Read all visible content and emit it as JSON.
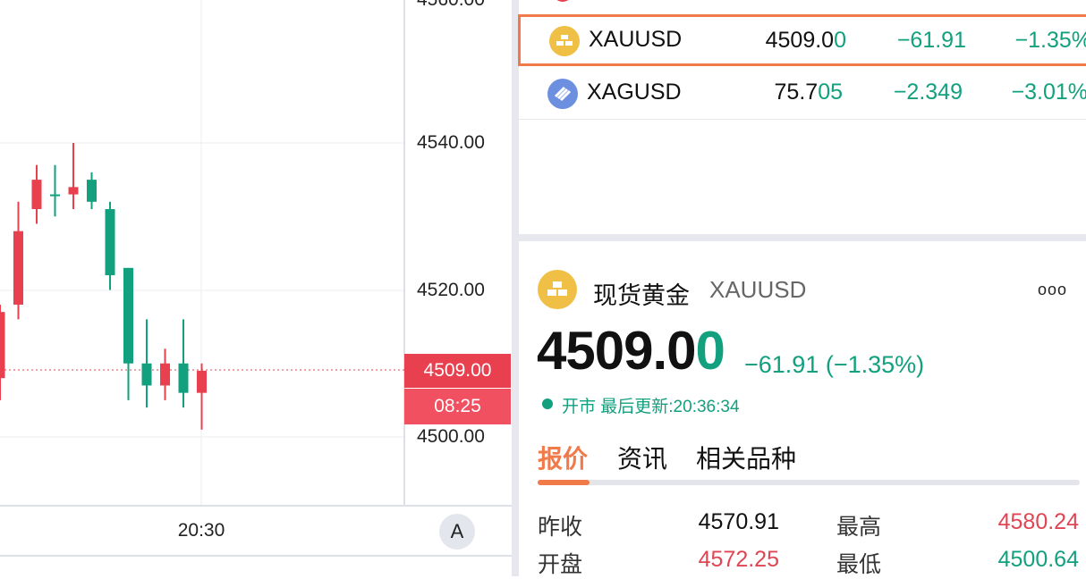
{
  "chart": {
    "price_axis": [
      "4540.00",
      "4520.00",
      "4500.00"
    ],
    "top_axis_partial": "4560.00",
    "current_price_tag": "4509.00",
    "countdown_tag": "08:25",
    "time_label": "20:30",
    "auto_button": "A",
    "colors": {
      "up": "#e8404f",
      "down": "#12a07e"
    }
  },
  "chart_data": {
    "type": "candlestick",
    "y_ticks": [
      4540,
      4520,
      4500
    ],
    "x_tick": "20:30",
    "current_price": 4509.0,
    "candles": [
      {
        "o": 4508,
        "c": 4517,
        "h": 4518,
        "l": 4505,
        "dir": "up"
      },
      {
        "o": 4518,
        "c": 4528,
        "h": 4532,
        "l": 4516,
        "dir": "up"
      },
      {
        "o": 4531,
        "c": 4535,
        "h": 4537,
        "l": 4529,
        "dir": "up"
      },
      {
        "o": 4533,
        "c": 4533,
        "h": 4537,
        "l": 4530,
        "dir": "down"
      },
      {
        "o": 4533,
        "c": 4534,
        "h": 4540,
        "l": 4531,
        "dir": "up"
      },
      {
        "o": 4535,
        "c": 4532,
        "h": 4536,
        "l": 4531,
        "dir": "down"
      },
      {
        "o": 4531,
        "c": 4522,
        "h": 4532,
        "l": 4520,
        "dir": "down"
      },
      {
        "o": 4523,
        "c": 4510,
        "h": 4523,
        "l": 4505,
        "dir": "down"
      },
      {
        "o": 4510,
        "c": 4507,
        "h": 4516,
        "l": 4504,
        "dir": "down"
      },
      {
        "o": 4507,
        "c": 4510,
        "h": 4512,
        "l": 4505,
        "dir": "up"
      },
      {
        "o": 4510,
        "c": 4506,
        "h": 4516,
        "l": 4504,
        "dir": "down"
      },
      {
        "o": 4506,
        "c": 4509,
        "h": 4510,
        "l": 4501,
        "dir": "up"
      }
    ]
  },
  "watchlist": {
    "rows": [
      {
        "symbol": "XAUUSD",
        "price_main": "4509.0",
        "price_tail": "0",
        "change": "−61.91",
        "pct": "−1.35%",
        "icon": "gold-bars-icon",
        "icon_color": "#f0c046"
      },
      {
        "symbol": "XAGUSD",
        "price_main": "75.7",
        "price_tail": "05",
        "change": "−2.349",
        "pct": "−3.01%",
        "icon": "silver-bars-icon",
        "icon_color": "#6c8fe0"
      }
    ]
  },
  "detail": {
    "name": "现货黄金",
    "symbol": "XAUUSD",
    "more": "ooo",
    "price_main": "4509.0",
    "price_tail": "0",
    "change": "−61.91 (−1.35%)",
    "status": "开市 最后更新:20:36:34",
    "tabs": [
      "报价",
      "资讯",
      "相关品种"
    ],
    "quotes": [
      {
        "label": "昨收",
        "value": "4570.91"
      },
      {
        "label": "最高",
        "value": "4580.24"
      },
      {
        "label": "开盘",
        "value": "4572.25"
      },
      {
        "label": "最低",
        "value": "4500.64"
      }
    ]
  }
}
